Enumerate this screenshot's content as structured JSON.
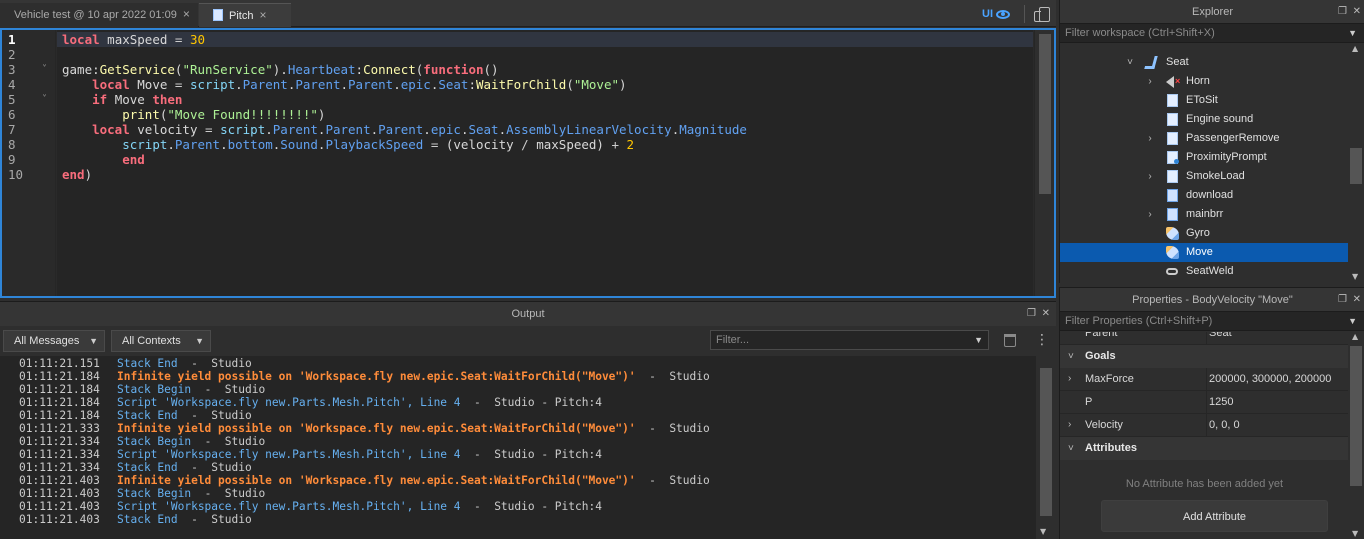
{
  "editor": {
    "tabs": [
      {
        "label": "Vehicle test @ 10 apr 2022 01:09",
        "close": "×"
      },
      {
        "label": "Pitch",
        "close": "×"
      }
    ],
    "ui_toggle_label": "UI",
    "line_numbers": [
      "1",
      "2",
      "3",
      "4",
      "5",
      "6",
      "7",
      "8",
      "9",
      "10"
    ],
    "fold_marker": "˅"
  },
  "output": {
    "title": "Output",
    "messages_filter": "All Messages",
    "contexts_filter": "All Contexts",
    "filter_placeholder": "Filter...",
    "kebab": "⋮",
    "lines": [
      {
        "time": "01:11:21.151",
        "msg": "Stack End",
        "suffix": "  -  Studio",
        "type": "info"
      },
      {
        "time": "01:11:21.184",
        "msg": "Infinite yield possible on 'Workspace.fly new.epic.Seat:WaitForChild(\"Move\")'",
        "suffix": "  -  Studio",
        "type": "warn"
      },
      {
        "time": "01:11:21.184",
        "msg": "Stack Begin",
        "suffix": "  -  Studio",
        "type": "info"
      },
      {
        "time": "01:11:21.184",
        "msg": "Script 'Workspace.fly new.Parts.Mesh.Pitch', Line 4",
        "suffix": "  -  Studio - Pitch:4",
        "type": "info"
      },
      {
        "time": "01:11:21.184",
        "msg": "Stack End",
        "suffix": "  -  Studio",
        "type": "info"
      },
      {
        "time": "01:11:21.333",
        "msg": "Infinite yield possible on 'Workspace.fly new.epic.Seat:WaitForChild(\"Move\")'",
        "suffix": "  -  Studio",
        "type": "warn"
      },
      {
        "time": "01:11:21.334",
        "msg": "Stack Begin",
        "suffix": "  -  Studio",
        "type": "info"
      },
      {
        "time": "01:11:21.334",
        "msg": "Script 'Workspace.fly new.Parts.Mesh.Pitch', Line 4",
        "suffix": "  -  Studio - Pitch:4",
        "type": "info"
      },
      {
        "time": "01:11:21.334",
        "msg": "Stack End",
        "suffix": "  -  Studio",
        "type": "info"
      },
      {
        "time": "01:11:21.403",
        "msg": "Infinite yield possible on 'Workspace.fly new.epic.Seat:WaitForChild(\"Move\")'",
        "suffix": "  -  Studio",
        "type": "warn"
      },
      {
        "time": "01:11:21.403",
        "msg": "Stack Begin",
        "suffix": "  -  Studio",
        "type": "info"
      },
      {
        "time": "01:11:21.403",
        "msg": "Script 'Workspace.fly new.Parts.Mesh.Pitch', Line 4",
        "suffix": "  -  Studio - Pitch:4",
        "type": "info"
      },
      {
        "time": "01:11:21.403",
        "msg": "Stack End",
        "suffix": "  -  Studio",
        "type": "info"
      }
    ]
  },
  "explorer": {
    "title": "Explorer",
    "filter_placeholder": "Filter workspace (Ctrl+Shift+X)",
    "items": [
      {
        "label": "Seat",
        "icon": "seat-icon",
        "expanded": true
      },
      {
        "label": "Horn",
        "icon": "sound-icon"
      },
      {
        "label": "EToSit",
        "icon": "script-icon"
      },
      {
        "label": "Engine sound",
        "icon": "script-icon"
      },
      {
        "label": "PassengerRemove",
        "icon": "script-icon"
      },
      {
        "label": "ProximityPrompt",
        "icon": "proximity-prompt-icon"
      },
      {
        "label": "SmokeLoad",
        "icon": "script-icon"
      },
      {
        "label": "download",
        "icon": "local-script-icon"
      },
      {
        "label": "mainbrr",
        "icon": "local-script-icon"
      },
      {
        "label": "Gyro",
        "icon": "body-mover-icon"
      },
      {
        "label": "Move",
        "icon": "body-mover-icon",
        "selected": true
      },
      {
        "label": "SeatWeld",
        "icon": "weld-icon"
      }
    ]
  },
  "properties": {
    "title": "Properties - BodyVelocity \"Move\"",
    "filter_placeholder": "Filter Properties (Ctrl+Shift+P)",
    "parent_row": {
      "name": "Parent",
      "value": "Seat"
    },
    "goals_section": "Goals",
    "rows": [
      {
        "name": "MaxForce",
        "value": "200000, 300000, 200000",
        "expandable": true
      },
      {
        "name": "P",
        "value": "1250",
        "expandable": false
      },
      {
        "name": "Velocity",
        "value": "0, 0, 0",
        "expandable": true
      }
    ],
    "attributes_section": "Attributes",
    "no_attributes_text": "No Attribute has been added yet",
    "add_attribute_label": "Add Attribute"
  },
  "colors": {
    "accent": "#2f85d8",
    "selection": "#0b5aaf",
    "warning": "#ff8c3a",
    "info": "#66b0f0"
  }
}
